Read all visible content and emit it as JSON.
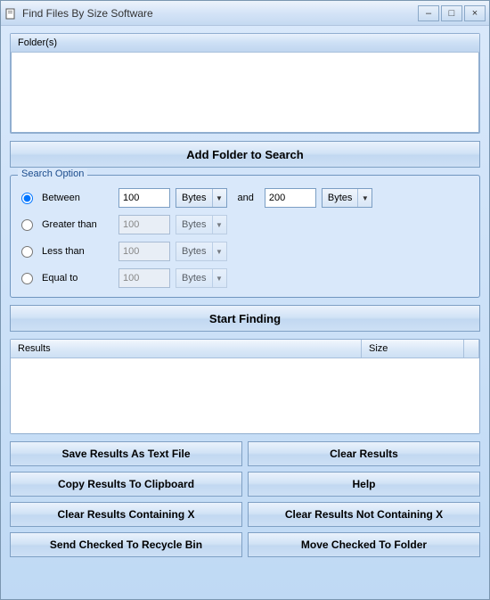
{
  "window": {
    "title": "Find Files By Size Software"
  },
  "folders": {
    "header": "Folder(s)"
  },
  "addFolderButton": "Add Folder to Search",
  "searchOption": {
    "legend": "Search Option",
    "between": {
      "label": "Between",
      "value1": "100",
      "unit1": "Bytes",
      "and": "and",
      "value2": "200",
      "unit2": "Bytes"
    },
    "greaterThan": {
      "label": "Greater than",
      "value": "100",
      "unit": "Bytes"
    },
    "lessThan": {
      "label": "Less than",
      "value": "100",
      "unit": "Bytes"
    },
    "equalTo": {
      "label": "Equal to",
      "value": "100",
      "unit": "Bytes"
    }
  },
  "startButton": "Start Finding",
  "results": {
    "colResults": "Results",
    "colSize": "Size"
  },
  "buttons": {
    "saveText": "Save Results As Text File",
    "clearResults": "Clear Results",
    "copyClipboard": "Copy Results To Clipboard",
    "help": "Help",
    "clearContaining": "Clear Results Containing X",
    "clearNotContaining": "Clear Results Not Containing X",
    "sendRecycle": "Send Checked To Recycle Bin",
    "moveFolder": "Move Checked To Folder"
  }
}
